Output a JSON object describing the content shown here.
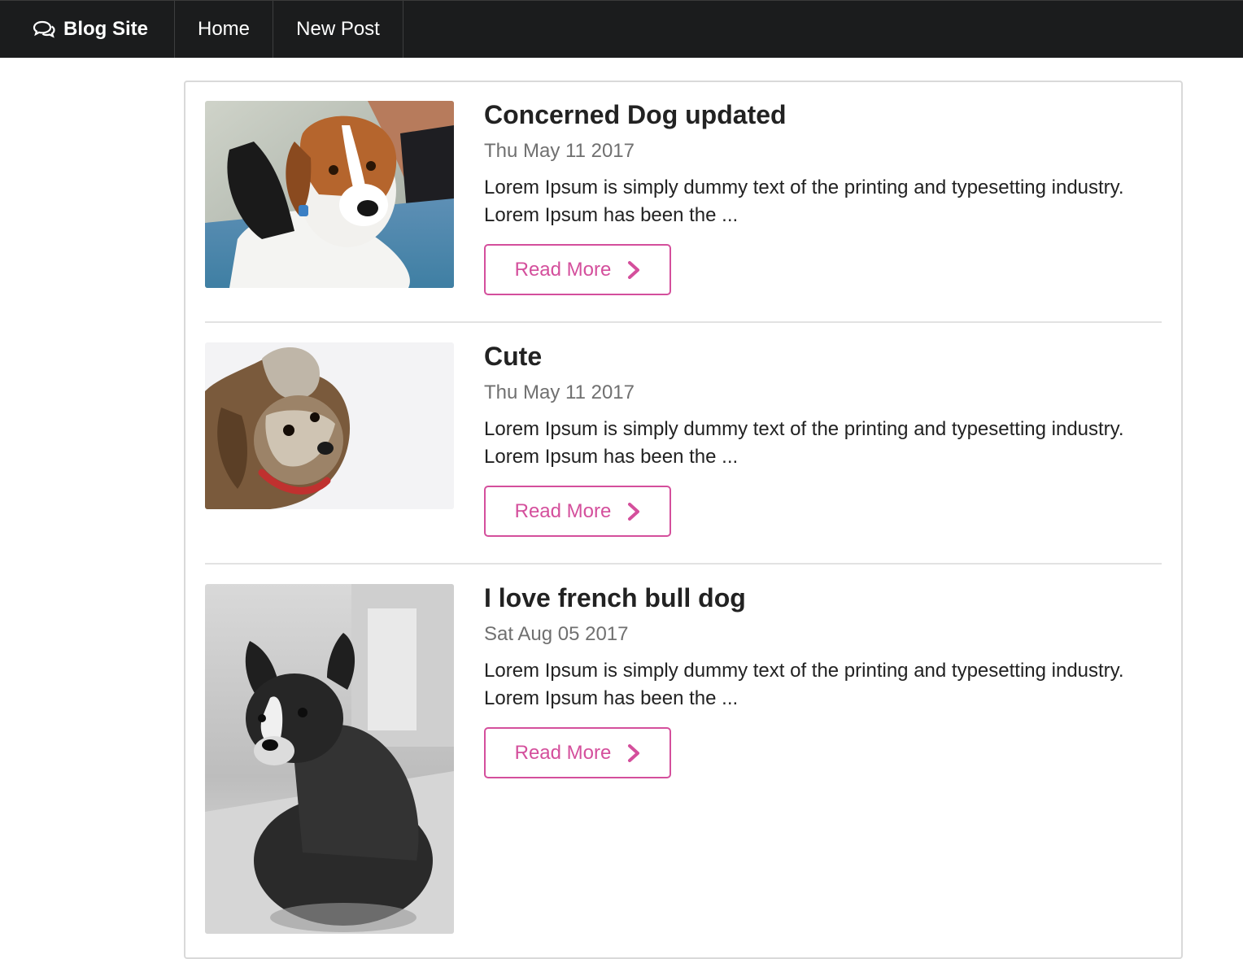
{
  "nav": {
    "brand": "Blog Site",
    "brand_icon": "comments-icon",
    "home": "Home",
    "new_post": "New Post"
  },
  "colors": {
    "navbar_bg": "#1b1c1d",
    "accent": "#d44f9c",
    "date_text": "#707070"
  },
  "posts": [
    {
      "title": "Concerned Dog updated",
      "date": "Thu May 11 2017",
      "excerpt": "Lorem Ipsum is simply dummy text of the printing and typesetting industry. Lorem Ipsum has been the ...",
      "button": "Read More",
      "button_icon": "chevron-right-icon",
      "image": "beagle-photo"
    },
    {
      "title": "Cute",
      "date": "Thu May 11 2017",
      "excerpt": "Lorem Ipsum is simply dummy text of the printing and typesetting industry. Lorem Ipsum has been the ...",
      "button": "Read More",
      "button_icon": "chevron-right-icon",
      "image": "terrier-photo"
    },
    {
      "title": "I love french bull dog",
      "date": "Sat Aug 05 2017",
      "excerpt": "Lorem Ipsum is simply dummy text of the printing and typesetting industry. Lorem Ipsum has been the ...",
      "button": "Read More",
      "button_icon": "chevron-right-icon",
      "image": "french-bulldog-photo"
    }
  ]
}
